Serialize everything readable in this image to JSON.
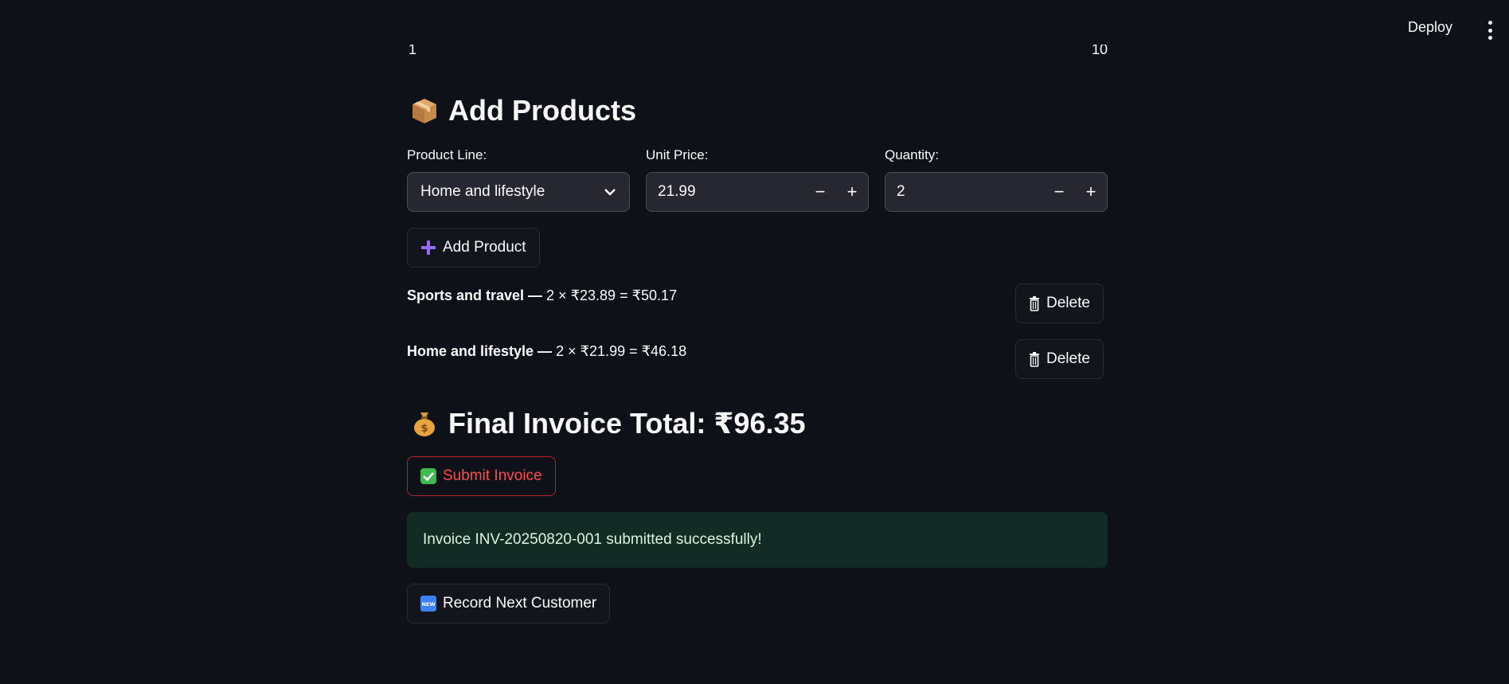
{
  "header": {
    "deploy_label": "Deploy",
    "menu_icon": "kebab-menu-icon"
  },
  "slider": {
    "min_label": "1",
    "max_label": "10"
  },
  "add_products": {
    "icon": "package-icon",
    "title": "Add Products",
    "product_line_label": "Product Line:",
    "product_line_value": "Home and lifestyle",
    "unit_price_label": "Unit Price:",
    "unit_price_value": "21.99",
    "quantity_label": "Quantity:",
    "quantity_value": "2",
    "minus": "−",
    "plus": "+",
    "add_button_label": "Add Product"
  },
  "items": [
    {
      "name": "Sports and travel —",
      "calc": " 2 × ₹23.89 = ₹50.17",
      "delete_label": "Delete"
    },
    {
      "name": "Home and lifestyle —",
      "calc": " 2 × ₹21.99 = ₹46.18",
      "delete_label": "Delete"
    }
  ],
  "total": {
    "icon": "money-bag-icon",
    "text": "Final Invoice Total: ₹96.35"
  },
  "submit_label": "Submit Invoice",
  "success_message": "Invoice INV-20250820-001 submitted successfully!",
  "next_label": "Record Next Customer",
  "colors": {
    "background": "#0e1117",
    "accent_red": "#ff4b4b",
    "success_bg": "#132b25",
    "plus_icon": "#9a6bff"
  }
}
